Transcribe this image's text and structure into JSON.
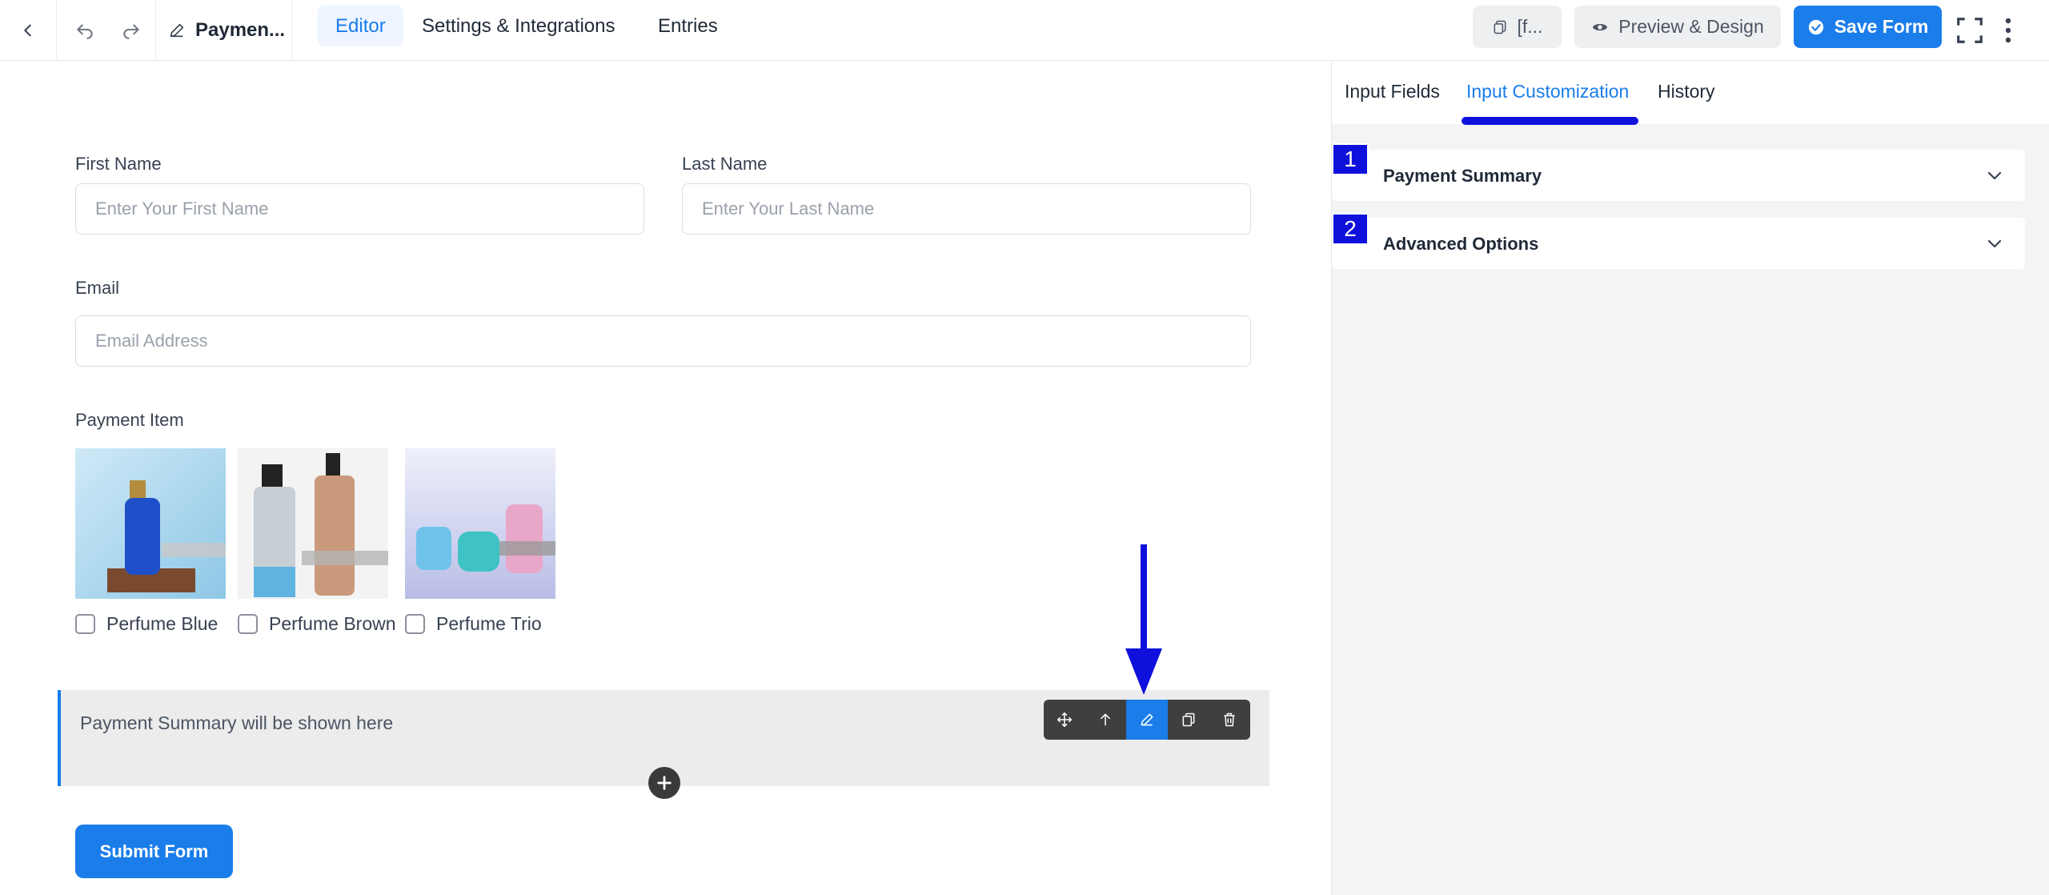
{
  "header": {
    "doc_title": "Paymen...",
    "tabs": [
      {
        "label": "Editor",
        "active": true
      },
      {
        "label": "Settings & Integrations",
        "active": false
      },
      {
        "label": "Entries",
        "active": false
      }
    ],
    "shortcode_label": "[f...",
    "preview_label": "Preview & Design",
    "save_label": "Save Form"
  },
  "form": {
    "first_name": {
      "label": "First Name",
      "placeholder": "Enter Your First Name"
    },
    "last_name": {
      "label": "Last Name",
      "placeholder": "Enter Your Last Name"
    },
    "email": {
      "label": "Email",
      "placeholder": "Email Address"
    },
    "payment_item": {
      "label": "Payment Item",
      "options": [
        "Perfume Blue",
        "Perfume Brown",
        "Perfume Trio"
      ]
    },
    "summary_text": "Payment Summary will be shown here",
    "submit_label": "Submit Form"
  },
  "sidebar": {
    "tabs": [
      {
        "label": "Input Fields",
        "active": false
      },
      {
        "label": "Input Customization",
        "active": true
      },
      {
        "label": "History",
        "active": false
      }
    ],
    "sections": [
      {
        "number": "1",
        "title": "Payment Summary"
      },
      {
        "number": "2",
        "title": "Advanced Options"
      }
    ]
  },
  "colors": {
    "accent": "#1a7dea",
    "annotation": "#1010dd"
  }
}
